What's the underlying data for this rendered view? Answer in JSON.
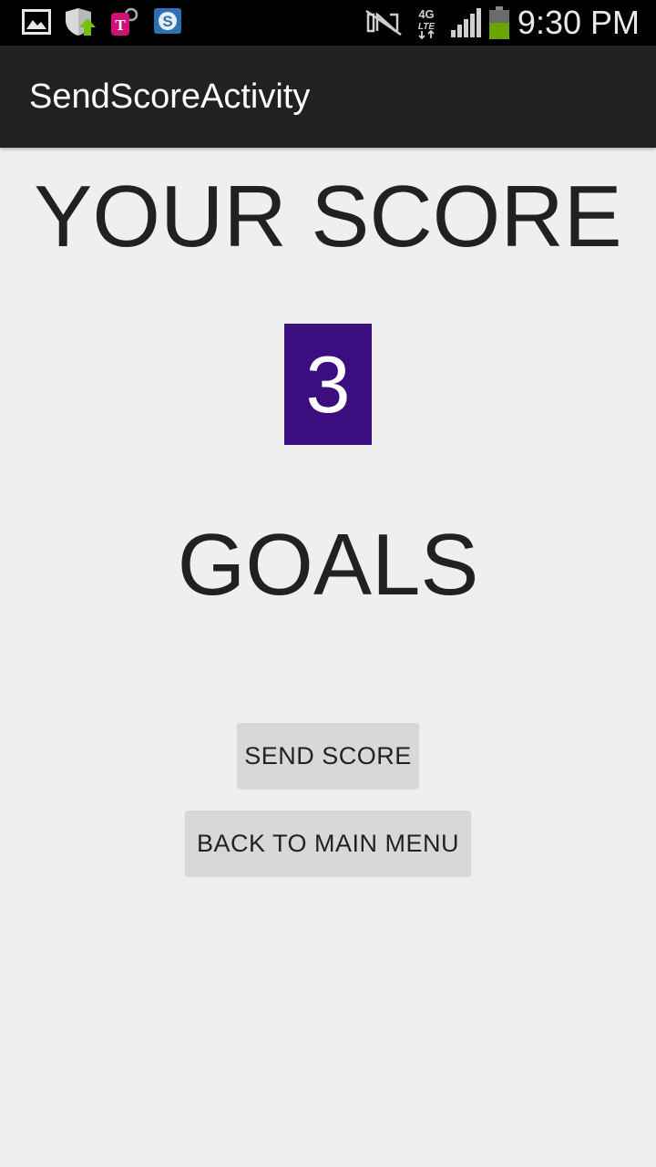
{
  "status_bar": {
    "left_icons": [
      "gallery-icon",
      "shield-upload-icon",
      "tmobile-icon",
      "s-app-icon"
    ],
    "right_icons": [
      "nfc-off-icon",
      "4g-lte-icon",
      "signal-icon",
      "battery-icon"
    ],
    "time": "9:30 PM"
  },
  "action_bar": {
    "title": "SendScoreActivity"
  },
  "main": {
    "heading": "YOUR SCORE",
    "score": "3",
    "unit": "GOALS",
    "score_bg_color": "#3c0d7e"
  },
  "buttons": {
    "send_score": "SEND SCORE",
    "back_to_main_menu": "BACK TO MAIN MENU"
  }
}
